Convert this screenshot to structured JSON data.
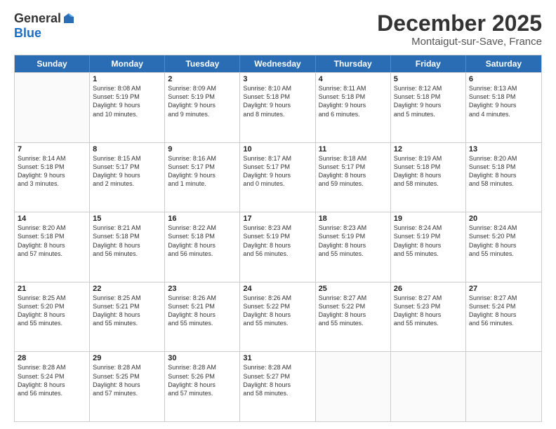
{
  "logo": {
    "general": "General",
    "blue": "Blue"
  },
  "title": "December 2025",
  "subtitle": "Montaigut-sur-Save, France",
  "header_days": [
    "Sunday",
    "Monday",
    "Tuesday",
    "Wednesday",
    "Thursday",
    "Friday",
    "Saturday"
  ],
  "weeks": [
    [
      {
        "day": "",
        "info": ""
      },
      {
        "day": "1",
        "info": "Sunrise: 8:08 AM\nSunset: 5:19 PM\nDaylight: 9 hours\nand 10 minutes."
      },
      {
        "day": "2",
        "info": "Sunrise: 8:09 AM\nSunset: 5:19 PM\nDaylight: 9 hours\nand 9 minutes."
      },
      {
        "day": "3",
        "info": "Sunrise: 8:10 AM\nSunset: 5:18 PM\nDaylight: 9 hours\nand 8 minutes."
      },
      {
        "day": "4",
        "info": "Sunrise: 8:11 AM\nSunset: 5:18 PM\nDaylight: 9 hours\nand 6 minutes."
      },
      {
        "day": "5",
        "info": "Sunrise: 8:12 AM\nSunset: 5:18 PM\nDaylight: 9 hours\nand 5 minutes."
      },
      {
        "day": "6",
        "info": "Sunrise: 8:13 AM\nSunset: 5:18 PM\nDaylight: 9 hours\nand 4 minutes."
      }
    ],
    [
      {
        "day": "7",
        "info": "Sunrise: 8:14 AM\nSunset: 5:18 PM\nDaylight: 9 hours\nand 3 minutes."
      },
      {
        "day": "8",
        "info": "Sunrise: 8:15 AM\nSunset: 5:17 PM\nDaylight: 9 hours\nand 2 minutes."
      },
      {
        "day": "9",
        "info": "Sunrise: 8:16 AM\nSunset: 5:17 PM\nDaylight: 9 hours\nand 1 minute."
      },
      {
        "day": "10",
        "info": "Sunrise: 8:17 AM\nSunset: 5:17 PM\nDaylight: 9 hours\nand 0 minutes."
      },
      {
        "day": "11",
        "info": "Sunrise: 8:18 AM\nSunset: 5:17 PM\nDaylight: 8 hours\nand 59 minutes."
      },
      {
        "day": "12",
        "info": "Sunrise: 8:19 AM\nSunset: 5:18 PM\nDaylight: 8 hours\nand 58 minutes."
      },
      {
        "day": "13",
        "info": "Sunrise: 8:20 AM\nSunset: 5:18 PM\nDaylight: 8 hours\nand 58 minutes."
      }
    ],
    [
      {
        "day": "14",
        "info": "Sunrise: 8:20 AM\nSunset: 5:18 PM\nDaylight: 8 hours\nand 57 minutes."
      },
      {
        "day": "15",
        "info": "Sunrise: 8:21 AM\nSunset: 5:18 PM\nDaylight: 8 hours\nand 56 minutes."
      },
      {
        "day": "16",
        "info": "Sunrise: 8:22 AM\nSunset: 5:18 PM\nDaylight: 8 hours\nand 56 minutes."
      },
      {
        "day": "17",
        "info": "Sunrise: 8:23 AM\nSunset: 5:19 PM\nDaylight: 8 hours\nand 56 minutes."
      },
      {
        "day": "18",
        "info": "Sunrise: 8:23 AM\nSunset: 5:19 PM\nDaylight: 8 hours\nand 55 minutes."
      },
      {
        "day": "19",
        "info": "Sunrise: 8:24 AM\nSunset: 5:19 PM\nDaylight: 8 hours\nand 55 minutes."
      },
      {
        "day": "20",
        "info": "Sunrise: 8:24 AM\nSunset: 5:20 PM\nDaylight: 8 hours\nand 55 minutes."
      }
    ],
    [
      {
        "day": "21",
        "info": "Sunrise: 8:25 AM\nSunset: 5:20 PM\nDaylight: 8 hours\nand 55 minutes."
      },
      {
        "day": "22",
        "info": "Sunrise: 8:25 AM\nSunset: 5:21 PM\nDaylight: 8 hours\nand 55 minutes."
      },
      {
        "day": "23",
        "info": "Sunrise: 8:26 AM\nSunset: 5:21 PM\nDaylight: 8 hours\nand 55 minutes."
      },
      {
        "day": "24",
        "info": "Sunrise: 8:26 AM\nSunset: 5:22 PM\nDaylight: 8 hours\nand 55 minutes."
      },
      {
        "day": "25",
        "info": "Sunrise: 8:27 AM\nSunset: 5:22 PM\nDaylight: 8 hours\nand 55 minutes."
      },
      {
        "day": "26",
        "info": "Sunrise: 8:27 AM\nSunset: 5:23 PM\nDaylight: 8 hours\nand 55 minutes."
      },
      {
        "day": "27",
        "info": "Sunrise: 8:27 AM\nSunset: 5:24 PM\nDaylight: 8 hours\nand 56 minutes."
      }
    ],
    [
      {
        "day": "28",
        "info": "Sunrise: 8:28 AM\nSunset: 5:24 PM\nDaylight: 8 hours\nand 56 minutes."
      },
      {
        "day": "29",
        "info": "Sunrise: 8:28 AM\nSunset: 5:25 PM\nDaylight: 8 hours\nand 57 minutes."
      },
      {
        "day": "30",
        "info": "Sunrise: 8:28 AM\nSunset: 5:26 PM\nDaylight: 8 hours\nand 57 minutes."
      },
      {
        "day": "31",
        "info": "Sunrise: 8:28 AM\nSunset: 5:27 PM\nDaylight: 8 hours\nand 58 minutes."
      },
      {
        "day": "",
        "info": ""
      },
      {
        "day": "",
        "info": ""
      },
      {
        "day": "",
        "info": ""
      }
    ]
  ]
}
